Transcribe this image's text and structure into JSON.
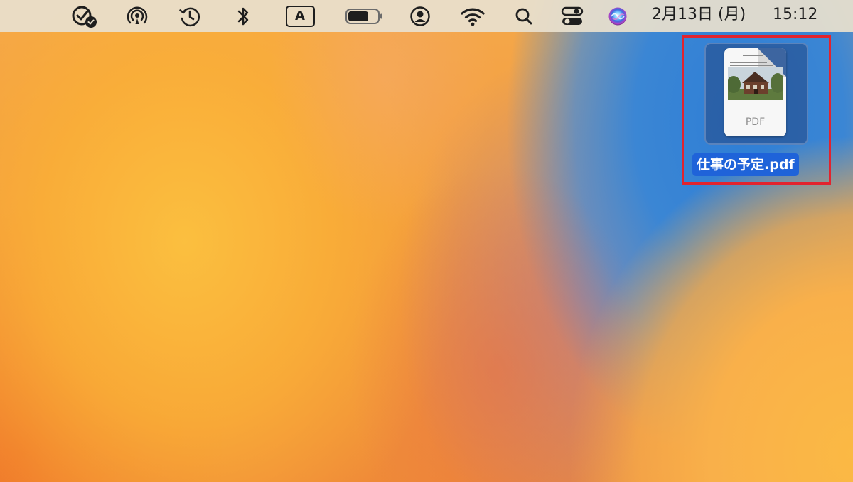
{
  "menubar": {
    "icons": [
      "task-check-icon",
      "airdrop-icon",
      "time-machine-icon",
      "bluetooth-icon",
      "input-source-icon",
      "battery-icon",
      "user-account-icon",
      "wifi-icon",
      "spotlight-search-icon",
      "control-center-icon",
      "siri-icon"
    ],
    "input_source_label": "A",
    "date": "2月13日 (月)",
    "time": "15:12"
  },
  "desktop": {
    "file": {
      "name": "仕事の予定.pdf",
      "thumbnail_label": "PDF",
      "selected": true
    }
  },
  "annotation": {
    "highlight_color": "#e2232e"
  },
  "colors": {
    "selection_blue": "#1f63d9",
    "wallpaper_orange": "#f19a3a",
    "wallpaper_blue": "#3b86d4"
  }
}
